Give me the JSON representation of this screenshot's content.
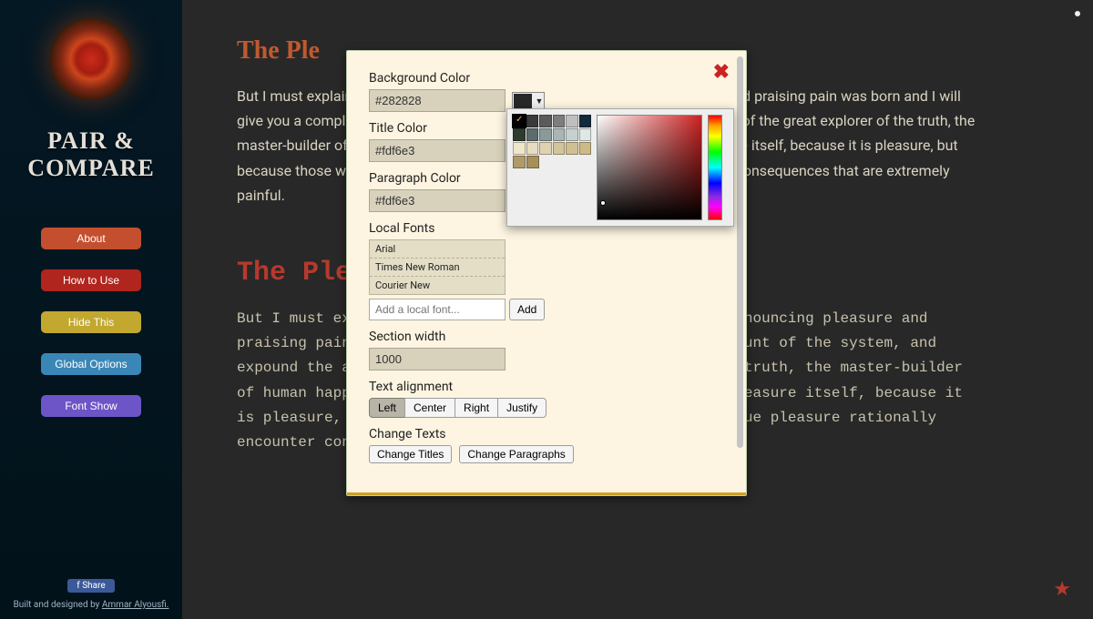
{
  "brand": {
    "line1": "PAIR &",
    "line2": "COMPARE"
  },
  "nav": {
    "about": "About",
    "howto": "How to Use",
    "hide": "Hide This",
    "global": "Global Options",
    "font": "Font Show"
  },
  "share_label": "Share",
  "credit": {
    "prefix": "Built and designed by ",
    "name": "Ammar Alyousfi."
  },
  "section1": {
    "title": "The Ple",
    "para": "But I must explain to you how all this mistaken idea of denouncing pleasure and praising pain was born and I will give you a complete account of the system, and expound the actual teachings of the great explorer of the truth, the master-builder of human happiness. No one rejects, dislikes, or avoids pleasure itself, because it is pleasure, but because those who do not know how to pursue pleasure rationally encounter consequences that are extremely painful."
  },
  "section2": {
    "title": "The Ple",
    "para": "But I must explain to you how all this mistaken idea of denouncing pleasure and praising pain was born and I will give you a complete account of the system, and expound the actual teachings of the great explorer of the truth, the master-builder of human happiness. No one rejects, dislikes, or avoids pleasure itself, because it is pleasure, but because those who do not know how to pursue pleasure rationally encounter consequences that are extremely painful."
  },
  "modal": {
    "bg_label": "Background Color",
    "bg_value": "#282828",
    "title_label": "Title Color",
    "title_value": "#fdf6e3",
    "para_label": "Paragraph Color",
    "para_value": "#fdf6e3",
    "local_fonts_label": "Local Fonts",
    "fonts": [
      "Arial",
      "Times New Roman",
      "Courier New"
    ],
    "add_font_placeholder": "Add a local font...",
    "add_btn": "Add",
    "width_label": "Section width",
    "width_value": "1000",
    "align_label": "Text alignment",
    "align": {
      "left": "Left",
      "center": "Center",
      "right": "Right",
      "justify": "Justify"
    },
    "change_label": "Change Texts",
    "change_titles": "Change Titles",
    "change_paras": "Change Paragraphs"
  },
  "palette_colors": [
    [
      "#000000",
      "#3a3a3a",
      "#5b5b5b",
      "#7d7d7d",
      "#bfbfbf",
      "#122a3a"
    ],
    [
      "#2e3a2e",
      "#5c6b6b",
      "#8a9a9a",
      "#aab5b5",
      "#c7d0d0",
      "#e0e7e7"
    ],
    [
      "#efe6cc",
      "#e7dcc0",
      "#e0d2b0",
      "#d4c49c",
      "#cfbf92",
      "#cdba88"
    ],
    [
      "#b09a6a",
      "#a78f5c"
    ]
  ]
}
